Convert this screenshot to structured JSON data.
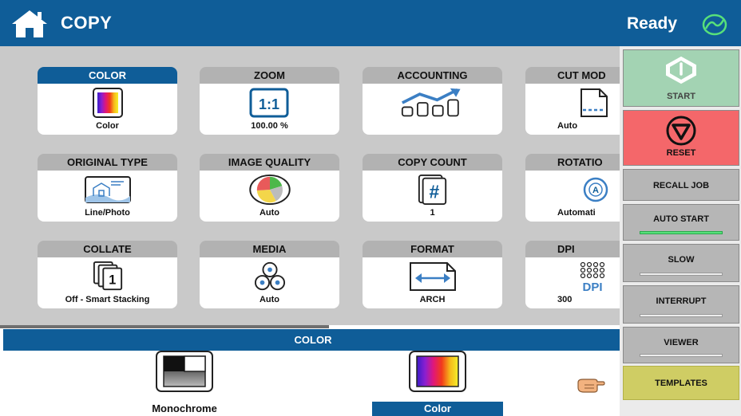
{
  "header": {
    "title": "COPY",
    "status": "Ready",
    "icons": {
      "home": "home-icon",
      "status": "ready-power-icon"
    }
  },
  "tiles": [
    {
      "label": "COLOR",
      "value": "Color",
      "icon": "color-gradient-icon",
      "active": true
    },
    {
      "label": "ZOOM",
      "value": "100.00 %",
      "icon": "zoom-1-1-icon",
      "icon_text": "1:1"
    },
    {
      "label": "ACCOUNTING",
      "value": "",
      "icon": "accounting-chart-icon"
    },
    {
      "label": "CUT MOD",
      "value": "Auto",
      "icon": "cut-mode-icon"
    },
    {
      "label": "ORIGINAL TYPE",
      "value": "Line/Photo",
      "icon": "line-photo-icon"
    },
    {
      "label": "IMAGE QUALITY",
      "value": "Auto",
      "icon": "pie-quality-icon"
    },
    {
      "label": "COPY COUNT",
      "value": "1",
      "icon": "copy-count-hash-icon",
      "icon_text": "#"
    },
    {
      "label": "ROTATIO",
      "value": "Automati",
      "icon": "rotation-auto-icon",
      "icon_text": "A"
    },
    {
      "label": "COLLATE",
      "value": "Off - Smart Stacking",
      "icon": "collate-stack-icon",
      "icon_text": "1"
    },
    {
      "label": "MEDIA",
      "value": "Auto",
      "icon": "media-rolls-icon"
    },
    {
      "label": "FORMAT",
      "value": "ARCH",
      "icon": "format-arrows-icon"
    },
    {
      "label": "DPI",
      "value": "300",
      "icon": "dpi-icon",
      "icon_text": "DPI"
    }
  ],
  "color_panel": {
    "title": "COLOR",
    "options": [
      {
        "label": "Monochrome",
        "icon": "monochrome-icon",
        "selected": false
      },
      {
        "label": "Color",
        "icon": "color-gradient-icon",
        "selected": true
      }
    ],
    "pointer_icon": "pointing-hand-icon"
  },
  "side_panel": {
    "start": {
      "label": "START",
      "icon": "start-power-icon"
    },
    "reset": {
      "label": "RESET",
      "icon": "reset-stop-icon"
    },
    "buttons": [
      {
        "label": "RECALL JOB",
        "indicator": false
      },
      {
        "label": "AUTO START",
        "indicator": true,
        "indicator_on": true
      },
      {
        "label": "SLOW",
        "indicator": true,
        "indicator_on": false
      },
      {
        "label": "INTERRUPT",
        "indicator": true,
        "indicator_on": false
      },
      {
        "label": "VIEWER",
        "indicator": true,
        "indicator_on": false
      }
    ],
    "templates": {
      "label": "TEMPLATES"
    }
  },
  "colors": {
    "brand_blue": "#0f5d98",
    "start_green": "#a3d3b3",
    "reset_red": "#f4676a",
    "templates_yellow": "#cfcd64",
    "auto_start_indicator": "#57e07a"
  }
}
